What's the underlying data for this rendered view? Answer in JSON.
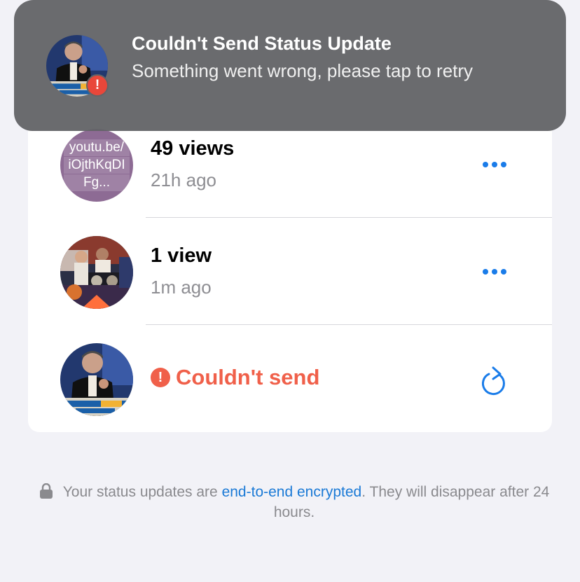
{
  "banner": {
    "title": "Couldn't Send Status Update",
    "body": "Something went wrong, please tap to retry",
    "icon": "alert-icon"
  },
  "status_items": [
    {
      "thumbnail_text": [
        "youtu.be/",
        "iOjthKqDI",
        "Fg..."
      ],
      "views": "49 views",
      "time": "21h ago",
      "action": "more-icon"
    },
    {
      "views": "1 view",
      "time": "1m ago",
      "action": "more-icon"
    },
    {
      "error_text": "Couldn't send",
      "action": "retry-icon"
    }
  ],
  "footer": {
    "text_before": "Your status updates are ",
    "link": "end-to-end encrypted",
    "text_after": ". They will disappear after 24 hours."
  },
  "colors": {
    "accent": "#1a7ce9",
    "error": "#f0604a",
    "background": "#f2f2f7",
    "banner": "#626366",
    "link_thumb": "#8d6b94"
  }
}
